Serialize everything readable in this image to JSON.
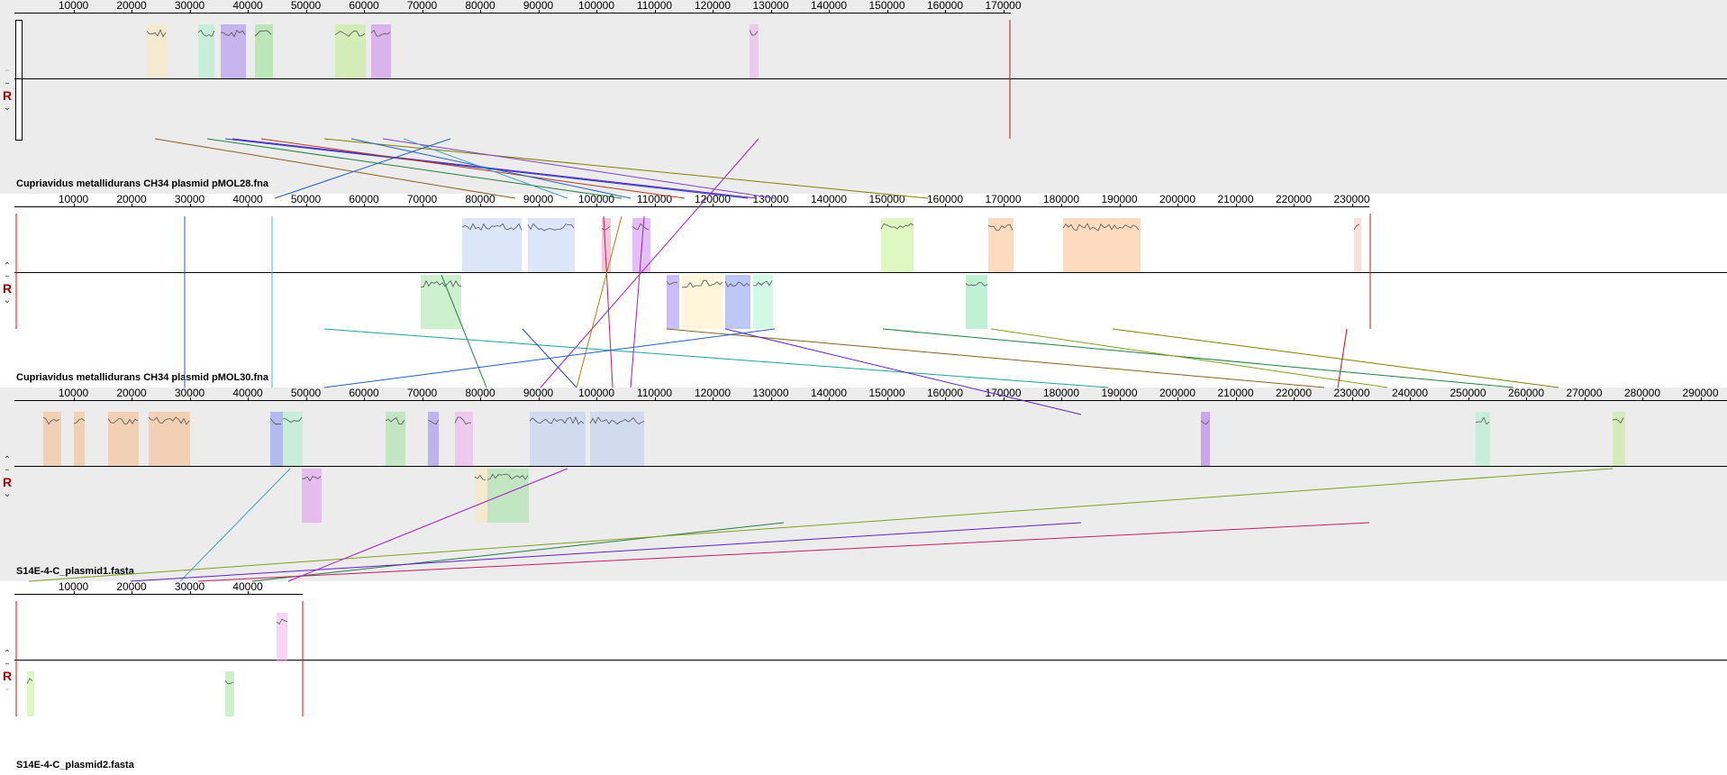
{
  "panels": [
    {
      "name": "Cupriavidus metallidurans CH34 plasmid pMOL28.fna",
      "ticks": [
        "10000",
        "20000",
        "30000",
        "40000",
        "50000",
        "60000",
        "70000",
        "80000",
        "90000",
        "100000",
        "110000",
        "120000",
        "130000",
        "140000",
        "150000",
        "160000",
        "170000"
      ]
    },
    {
      "name": "Cupriavidus metallidurans CH34 plasmid pMOL30.fna",
      "ticks": [
        "10000",
        "20000",
        "30000",
        "40000",
        "50000",
        "60000",
        "70000",
        "80000",
        "90000",
        "100000",
        "110000",
        "120000",
        "130000",
        "140000",
        "150000",
        "160000",
        "170000",
        "180000",
        "190000",
        "200000",
        "210000",
        "220000",
        "230000"
      ]
    },
    {
      "name": "S14E-4-C_plasmid1.fasta",
      "ticks": [
        "10000",
        "20000",
        "30000",
        "40000",
        "50000",
        "60000",
        "70000",
        "80000",
        "90000",
        "100000",
        "110000",
        "120000",
        "130000",
        "140000",
        "150000",
        "160000",
        "170000",
        "180000",
        "190000",
        "200000",
        "210000",
        "220000",
        "230000",
        "240000",
        "250000",
        "260000",
        "270000",
        "280000",
        "290000"
      ]
    },
    {
      "name": "S14E-4-C_plasmid2.fasta",
      "ticks": [
        "10000",
        "20000",
        "30000",
        "40000"
      ]
    }
  ],
  "controls": {
    "up": "▲",
    "minus": "–",
    "r": "R",
    "down": "▼"
  },
  "colors": {
    "panel_bg_alt": "#ececec",
    "panel_bg": "#ffffff",
    "end_line": "#d01010"
  }
}
